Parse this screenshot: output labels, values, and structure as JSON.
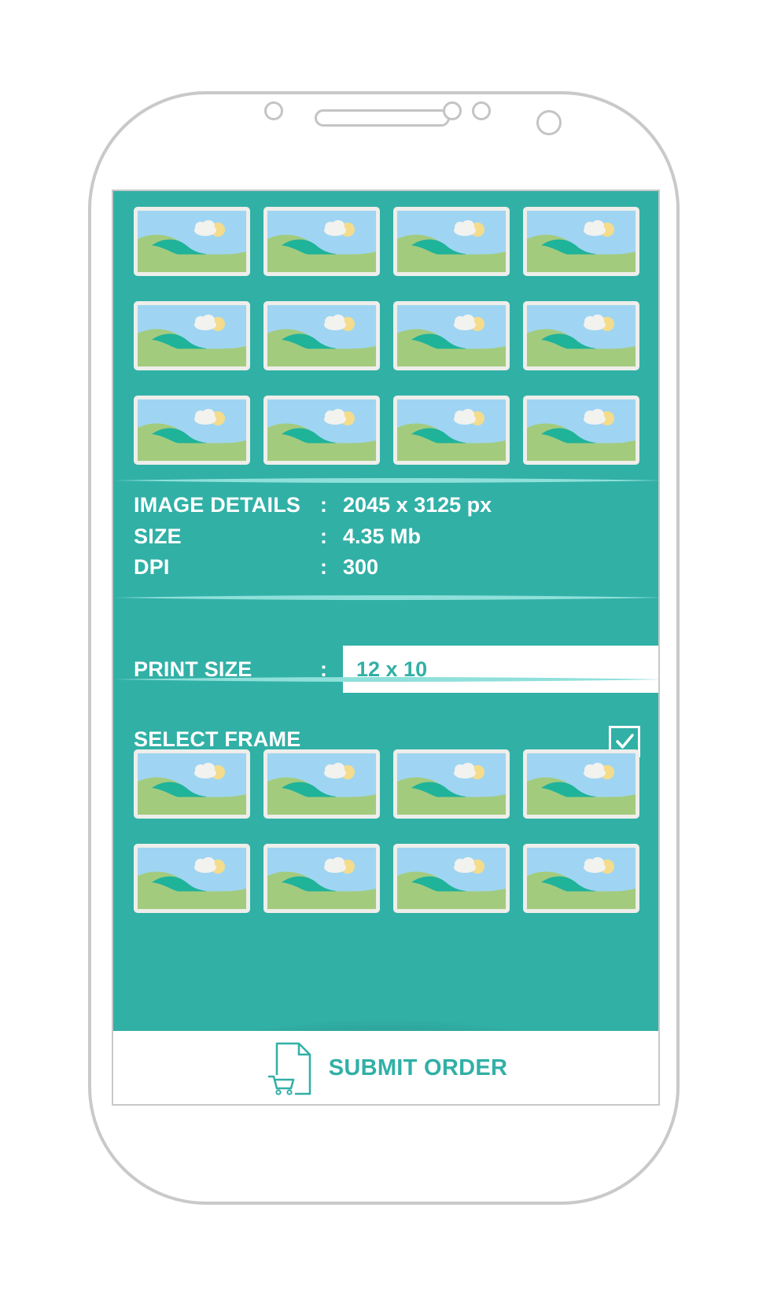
{
  "colors": {
    "accent": "#31b0a6",
    "frame": "#c9c9c9",
    "field_bg": "#ffffff"
  },
  "gallery": {
    "rows": 3,
    "columns": 4,
    "thumb_icon": "landscape-image-icon"
  },
  "details": [
    {
      "label": "IMAGE DETAILS",
      "colon": ":",
      "value": "2045 x 3125 px"
    },
    {
      "label": "SIZE",
      "colon": ":",
      "value": "4.35 Mb"
    },
    {
      "label": "DPI",
      "colon": ":",
      "value": "300"
    }
  ],
  "print_size": {
    "label": "PRINT SIZE",
    "colon": ":",
    "value": "12 x 10"
  },
  "select_frame": {
    "label": "SELECT FRAME",
    "checked": true,
    "check_icon": "checkmark-icon",
    "rows": 2,
    "columns": 4
  },
  "submit": {
    "label": "SUBMIT ORDER",
    "icon": "document-cart-icon"
  }
}
